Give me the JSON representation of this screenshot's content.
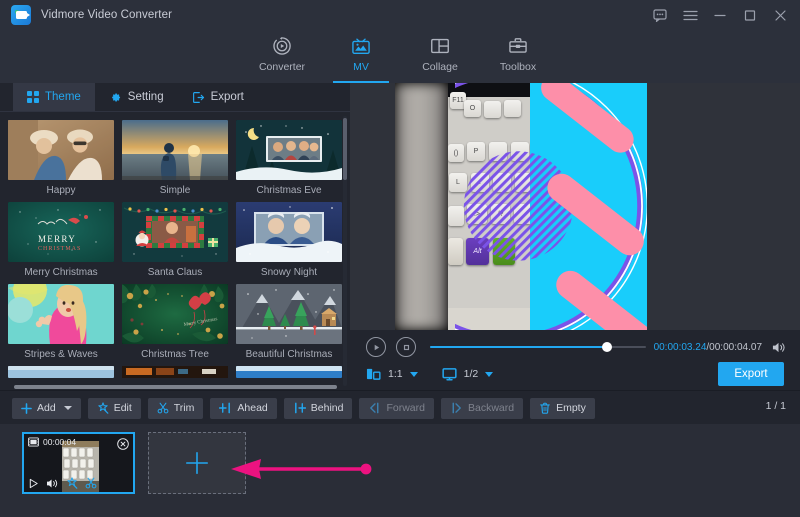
{
  "window": {
    "title": "Vidmore Video Converter",
    "logo_icon": "app-logo-icon",
    "controls": [
      {
        "name": "feedback-icon",
        "label": "Feedback"
      },
      {
        "name": "menu-icon",
        "label": "Menu"
      },
      {
        "name": "minimize-icon",
        "label": "Minimize"
      },
      {
        "name": "maximize-icon",
        "label": "Maximize"
      },
      {
        "name": "close-icon",
        "label": "Close"
      }
    ]
  },
  "topnav": {
    "items": [
      {
        "label": "Converter",
        "icon": "converter-icon",
        "active": false
      },
      {
        "label": "MV",
        "icon": "mv-icon",
        "active": true
      },
      {
        "label": "Collage",
        "icon": "collage-icon",
        "active": false
      },
      {
        "label": "Toolbox",
        "icon": "toolbox-icon",
        "active": false
      }
    ],
    "accent": "#22a7f0"
  },
  "tabs": [
    {
      "label": "Theme",
      "icon": "grid-icon",
      "active": true
    },
    {
      "label": "Setting",
      "icon": "gear-icon",
      "active": false
    },
    {
      "label": "Export",
      "icon": "export-icon",
      "active": false
    }
  ],
  "themes": [
    {
      "name": "Happy"
    },
    {
      "name": "Simple"
    },
    {
      "name": "Christmas Eve"
    },
    {
      "name": "Merry Christmas"
    },
    {
      "name": "Santa Claus"
    },
    {
      "name": "Snowy Night"
    },
    {
      "name": "Stripes & Waves"
    },
    {
      "name": "Christmas Tree"
    },
    {
      "name": "Beautiful Christmas"
    }
  ],
  "player": {
    "play_icon": "play-icon",
    "stop_icon": "stop-icon",
    "current_time": "00:00:03.24",
    "separator": "/",
    "total_time": "00:00:04.07",
    "volume_icon": "speaker-icon",
    "progress_percent": 82,
    "aspect_ratio": "1:1",
    "aspect_icon": "aspect-ratio-icon",
    "screen_scale": "1/2",
    "screen_icon": "monitor-icon",
    "export_label": "Export",
    "accent": "#22a7f0"
  },
  "toolbar": {
    "buttons": [
      {
        "label": "Add",
        "icon": "plus-icon",
        "dropdown": true,
        "disabled": false
      },
      {
        "label": "Edit",
        "icon": "magic-wand-icon",
        "dropdown": false,
        "disabled": false
      },
      {
        "label": "Trim",
        "icon": "scissors-icon",
        "dropdown": false,
        "disabled": false
      },
      {
        "label": "Ahead",
        "icon": "insert-ahead-icon",
        "dropdown": false,
        "disabled": false
      },
      {
        "label": "Behind",
        "icon": "insert-behind-icon",
        "dropdown": false,
        "disabled": false
      },
      {
        "label": "Forward",
        "icon": "move-forward-icon",
        "dropdown": false,
        "disabled": true
      },
      {
        "label": "Backward",
        "icon": "move-backward-icon",
        "dropdown": false,
        "disabled": true
      },
      {
        "label": "Empty",
        "icon": "trash-icon",
        "dropdown": false,
        "disabled": false
      }
    ],
    "page_indicator": "1 / 1"
  },
  "storyboard": {
    "clip": {
      "duration": "00:00:04",
      "film_icon": "film-icon",
      "close_icon": "close-circle-icon",
      "play_icon": "play-icon",
      "volume_icon": "speaker-icon",
      "edit_icon": "magic-wand-icon",
      "trim_icon": "scissors-icon",
      "selected_border": "#22a7f0"
    },
    "add_slot": {
      "icon": "plus-icon",
      "label": ""
    }
  },
  "annotation": {
    "arrow_color": "#ec1280",
    "points_to": "add-clip-slot"
  }
}
